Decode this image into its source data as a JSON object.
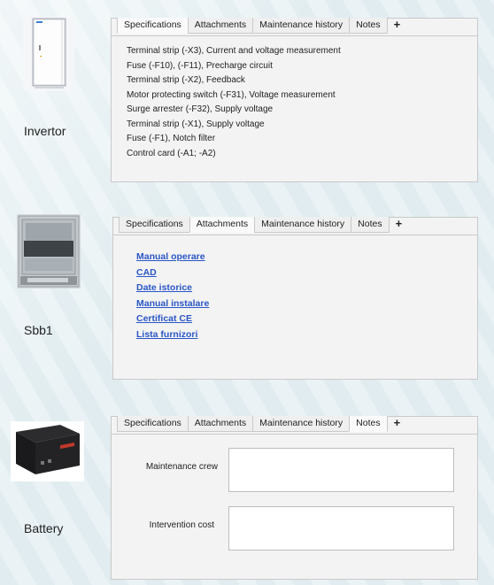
{
  "tabs": [
    "Specifications",
    "Attachments",
    "Maintenance history",
    "Notes",
    "+"
  ],
  "devices": [
    {
      "name": "Invertor",
      "active_tab": "Specifications",
      "specifications": [
        "Terminal strip (-X3), Current and voltage measurement",
        "Fuse (-F10), (-F11), Precharge circuit",
        "Terminal strip (-X2), Feedback",
        "Motor protecting switch (-F31), Voltage measurement",
        "Surge arrester (-F32), Supply voltage",
        "Terminal strip (-X1), Supply voltage",
        "Fuse (-F1), Notch filter",
        "Control card (-A1; -A2)"
      ]
    },
    {
      "name": "Sbb1",
      "active_tab": "Attachments",
      "attachments": [
        "Manual operare",
        "CAD",
        "Date istorice",
        "Manual instalare",
        "Certificat CE",
        "Lista furnizori"
      ]
    },
    {
      "name": "Battery",
      "active_tab": "Notes",
      "notes": {
        "crew_label": "Maintenance crew",
        "crew_value": "",
        "cost_label": "Intervention cost",
        "cost_value": ""
      }
    }
  ],
  "colors": {
    "link": "#2a56c6",
    "panel_bg": "#f3f3f3",
    "border": "#c9c9c9"
  }
}
